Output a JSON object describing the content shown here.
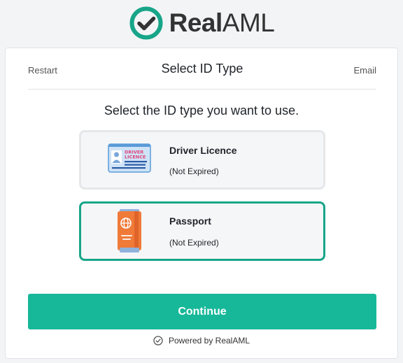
{
  "brand": {
    "name_bold": "Real",
    "name_light": "AML",
    "accent": "#17a589"
  },
  "header": {
    "restart_label": "Restart",
    "title": "Select ID Type",
    "email_label": "Email"
  },
  "prompt": "Select the ID type you want to use.",
  "options": [
    {
      "name": "Driver Licence",
      "status": "(Not Expired)",
      "icon": "driver-licence-icon",
      "card_text_1": "DRIVER",
      "card_text_2": "LICENCE",
      "selected": false
    },
    {
      "name": "Passport",
      "status": "(Not Expired)",
      "icon": "passport-icon",
      "selected": true
    }
  ],
  "continue_label": "Continue",
  "footer": {
    "powered_by": "Powered by",
    "brand": "RealAML"
  },
  "colors": {
    "primary": "#17b899",
    "selected_border": "#17a589",
    "card_bg": "#f5f6f8"
  }
}
